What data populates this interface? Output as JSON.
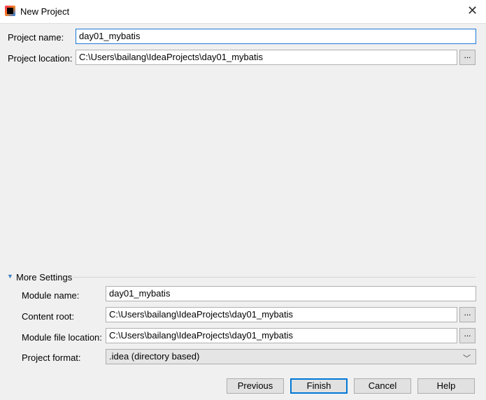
{
  "window": {
    "title": "New Project",
    "icon": "intellij-idea-icon",
    "close": "✕"
  },
  "project": {
    "name_label": "Project name:",
    "name_value": "day01_mybatis",
    "location_label": "Project location:",
    "location_value": "C:\\Users\\bailang\\IdeaProjects\\day01_mybatis",
    "browse": "..."
  },
  "more": {
    "label": "More Settings",
    "module_name_label": "Module name:",
    "module_name_value": "day01_mybatis",
    "content_root_label": "Content root:",
    "content_root_value": "C:\\Users\\bailang\\IdeaProjects\\day01_mybatis",
    "module_file_label": "Module file location:",
    "module_file_value": "C:\\Users\\bailang\\IdeaProjects\\day01_mybatis",
    "format_label": "Project format:",
    "format_value": ".idea (directory based)",
    "browse": "..."
  },
  "buttons": {
    "previous": "Previous",
    "finish": "Finish",
    "cancel": "Cancel",
    "help": "Help"
  },
  "colors": {
    "focus": "#1e78d7",
    "default_button": "#0078d7"
  }
}
